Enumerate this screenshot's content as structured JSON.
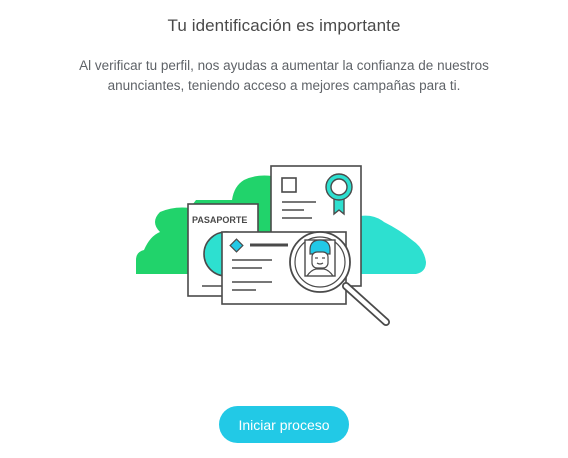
{
  "header": {
    "title": "Tu identificación es importante",
    "description": "Al verificar tu perfil, nos ayudas a aumentar la confianza de nuestros anunciantes, teniendo acceso a mejores campañas para ti."
  },
  "illustration": {
    "passport_label": "PASAPORTE",
    "colors": {
      "green": "#21d36b",
      "cyan": "#2de0d0",
      "outline": "#4a4a4a",
      "accent": "#22c9e6"
    }
  },
  "actions": {
    "start_label": "Iniciar proceso"
  }
}
